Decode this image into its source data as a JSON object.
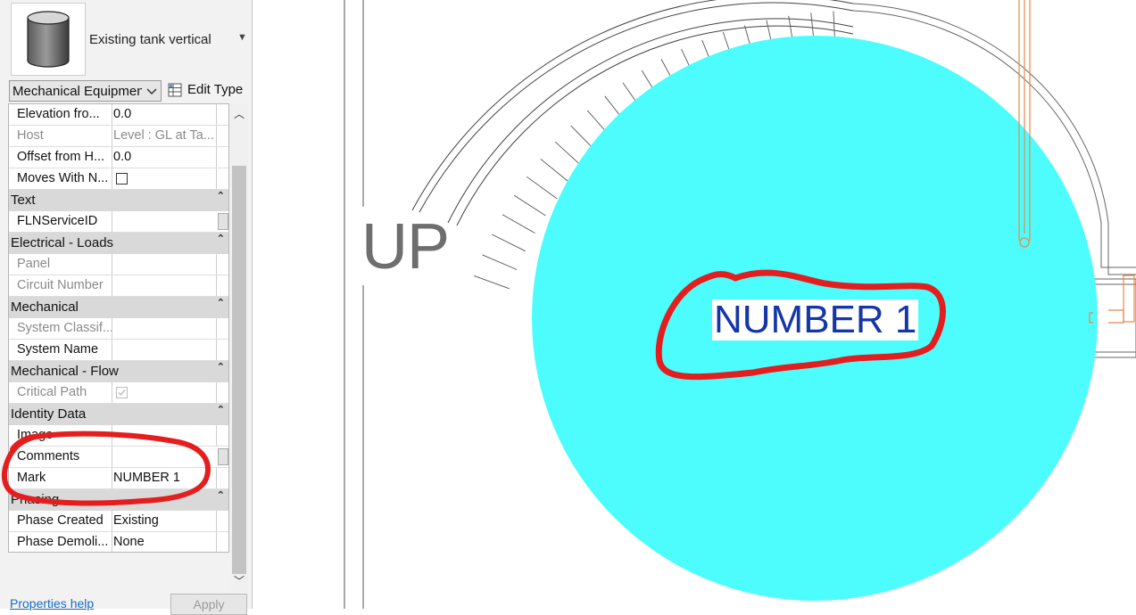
{
  "type_selector": {
    "name": "Existing tank vertical",
    "preview_icon": "cylinder-tank-icon",
    "dropdown_icon": "caret-down-icon"
  },
  "category": {
    "value": "Mechanical Equipment"
  },
  "edit_type": {
    "label": "Edit Type",
    "icon": "edit-type-icon"
  },
  "properties": {
    "rows": [
      {
        "label": "Elevation fro...",
        "value": "0.0"
      },
      {
        "label": "Host",
        "value": "Level : GL at Ta..."
      },
      {
        "label": "Offset from H...",
        "value": "0.0"
      },
      {
        "label": "Moves With N...",
        "value": ""
      },
      {
        "group": "Text"
      },
      {
        "label": "FLNServiceID",
        "value": ""
      },
      {
        "group": "Electrical - Loads"
      },
      {
        "label": "Panel",
        "value": ""
      },
      {
        "label": "Circuit Number",
        "value": ""
      },
      {
        "group": "Mechanical"
      },
      {
        "label": "System Classif...",
        "value": ""
      },
      {
        "label": "System Name",
        "value": ""
      },
      {
        "group": "Mechanical - Flow"
      },
      {
        "label": "Critical Path",
        "value": ""
      },
      {
        "group": "Identity Data"
      },
      {
        "label": "Image",
        "value": ""
      },
      {
        "label": "Comments",
        "value": ""
      },
      {
        "label": "Mark",
        "value": "NUMBER 1"
      },
      {
        "group": "Phasing"
      },
      {
        "label": "Phase Created",
        "value": "Existing"
      },
      {
        "label": "Phase Demoli...",
        "value": "None"
      }
    ],
    "collapse_glyph": "˄"
  },
  "footer": {
    "help_link": "Properties help",
    "apply_label": "Apply"
  },
  "canvas": {
    "up_text": "UP",
    "tag_text": "NUMBER 1",
    "tank_fill": "#4dfdfd",
    "tag_color": "#1536a8",
    "markup_color": "#e41e1e",
    "pipe_color": "#e5884a"
  }
}
